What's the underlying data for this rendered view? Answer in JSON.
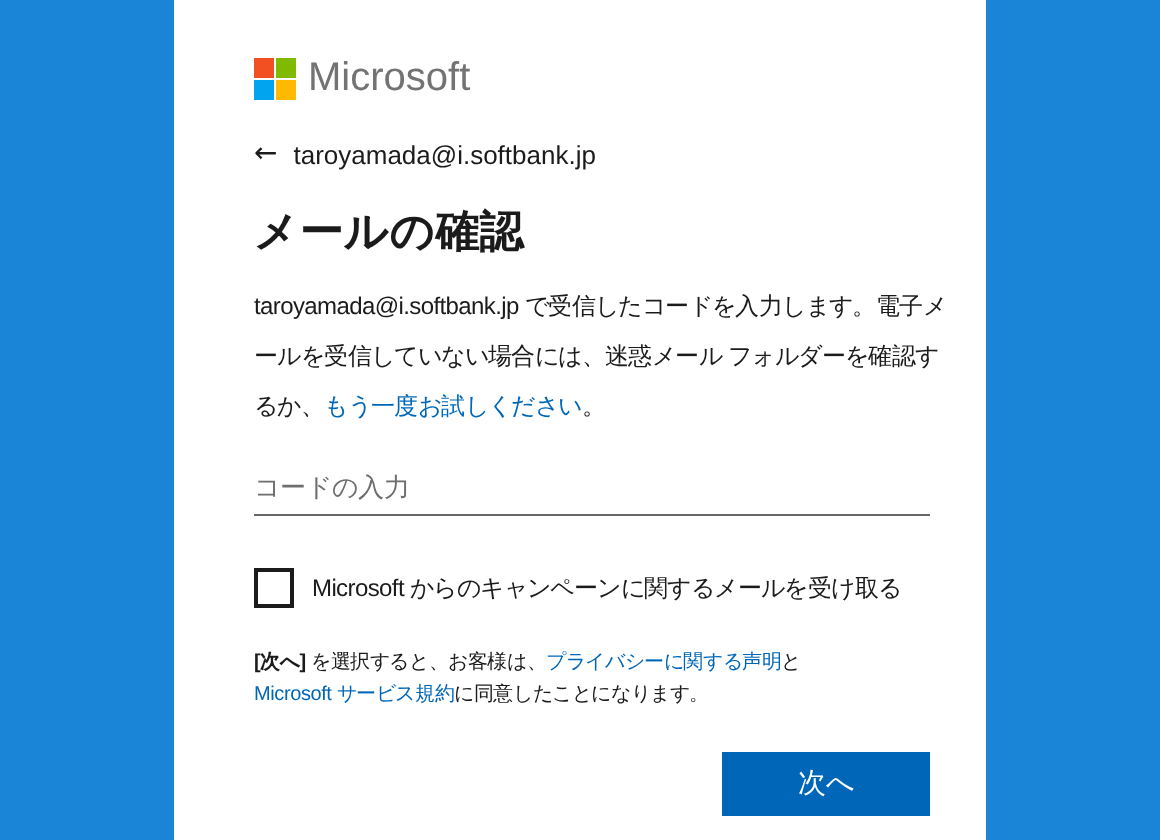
{
  "brand": {
    "name": "Microsoft"
  },
  "back": {
    "icon": "←",
    "email": "taroyamada@i.softbank.jp"
  },
  "title": "メールの確認",
  "description": [
    {
      "kind": "text",
      "text": "taroyamada@i.softbank.jp で受信したコードを入力します。電子メールを受信していない場合には、迷惑メール フォルダーを確認するか、"
    },
    {
      "kind": "link",
      "text": "もう一度お試しください"
    },
    {
      "kind": "text",
      "text": "。"
    }
  ],
  "code_field": {
    "placeholder": "コードの入力"
  },
  "marketing_checkbox": {
    "label": "Microsoft からのキャンペーンに関するメールを受け取る",
    "checked": false
  },
  "legal": [
    {
      "kind": "text",
      "text": "**[次へ]** を選択すると、お客様は、"
    },
    {
      "kind": "link",
      "text": "プライバシーに関する声明"
    },
    {
      "kind": "text",
      "text": "と "
    },
    {
      "kind": "link",
      "text": "Microsoft サービス規約"
    },
    {
      "kind": "text",
      "text": "に同意したことになります。"
    }
  ],
  "next_button": {
    "label": "次へ"
  }
}
